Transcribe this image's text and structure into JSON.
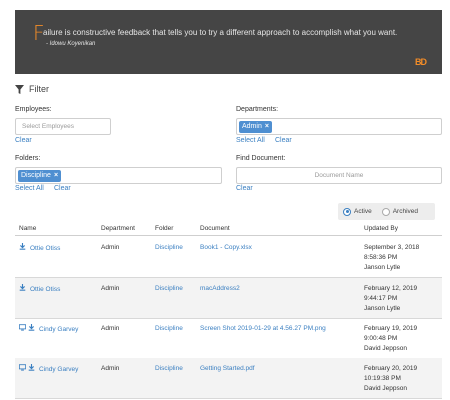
{
  "quote": {
    "first_letter": "F",
    "text": "ailure is constructive feedback that tells you to try a different approach to accomplish what you want.",
    "author": "- Idowu Koyenikan",
    "logo": "BD"
  },
  "filter": {
    "title": "Filter",
    "employees": {
      "label": "Employees:",
      "placeholder": "Select Employees",
      "clear": "Clear"
    },
    "departments": {
      "label": "Departments:",
      "tag": "Admin",
      "select_all": "Select All",
      "clear": "Clear"
    },
    "folders": {
      "label": "Folders:",
      "tag": "Discipline",
      "select_all": "Select All",
      "clear": "Clear"
    },
    "find_document": {
      "label": "Find Document:",
      "placeholder": "Document Name",
      "clear": "Clear"
    }
  },
  "status_toggle": {
    "active": "Active",
    "archived": "Archived",
    "selected": "Active"
  },
  "table": {
    "columns": [
      "Name",
      "Department",
      "Folder",
      "Document",
      "Updated By"
    ],
    "rows": [
      {
        "name": "Ottie Otiss",
        "department": "Admin",
        "folder": "Discipline",
        "document": "Book1 - Copy.xlsx",
        "date": "September 3, 2018",
        "time": "8:58:36 PM",
        "by": "Janson Lytle",
        "has_view": false
      },
      {
        "name": "Ottie Otiss",
        "department": "Admin",
        "folder": "Discipline",
        "document": "macAddress2",
        "date": "February 12, 2019",
        "time": "9:44:17 PM",
        "by": "Janson Lytle",
        "has_view": false
      },
      {
        "name": "Cindy Garvey",
        "department": "Admin",
        "folder": "Discipline",
        "document": "Screen Shot 2019-01-29 at 4.56.27 PM.png",
        "date": "February 19, 2019",
        "time": "9:00:48 PM",
        "by": "David Jeppson",
        "has_view": true
      },
      {
        "name": "Cindy Garvey",
        "department": "Admin",
        "folder": "Discipline",
        "document": "Getting Started.pdf",
        "date": "February 20, 2019",
        "time": "10:19:38 PM",
        "by": "David Jeppson",
        "has_view": true
      }
    ]
  },
  "colors": {
    "accent": "#f28c28",
    "link": "#3a7fc1",
    "tag": "#4f8fd1",
    "banner": "#454545"
  }
}
